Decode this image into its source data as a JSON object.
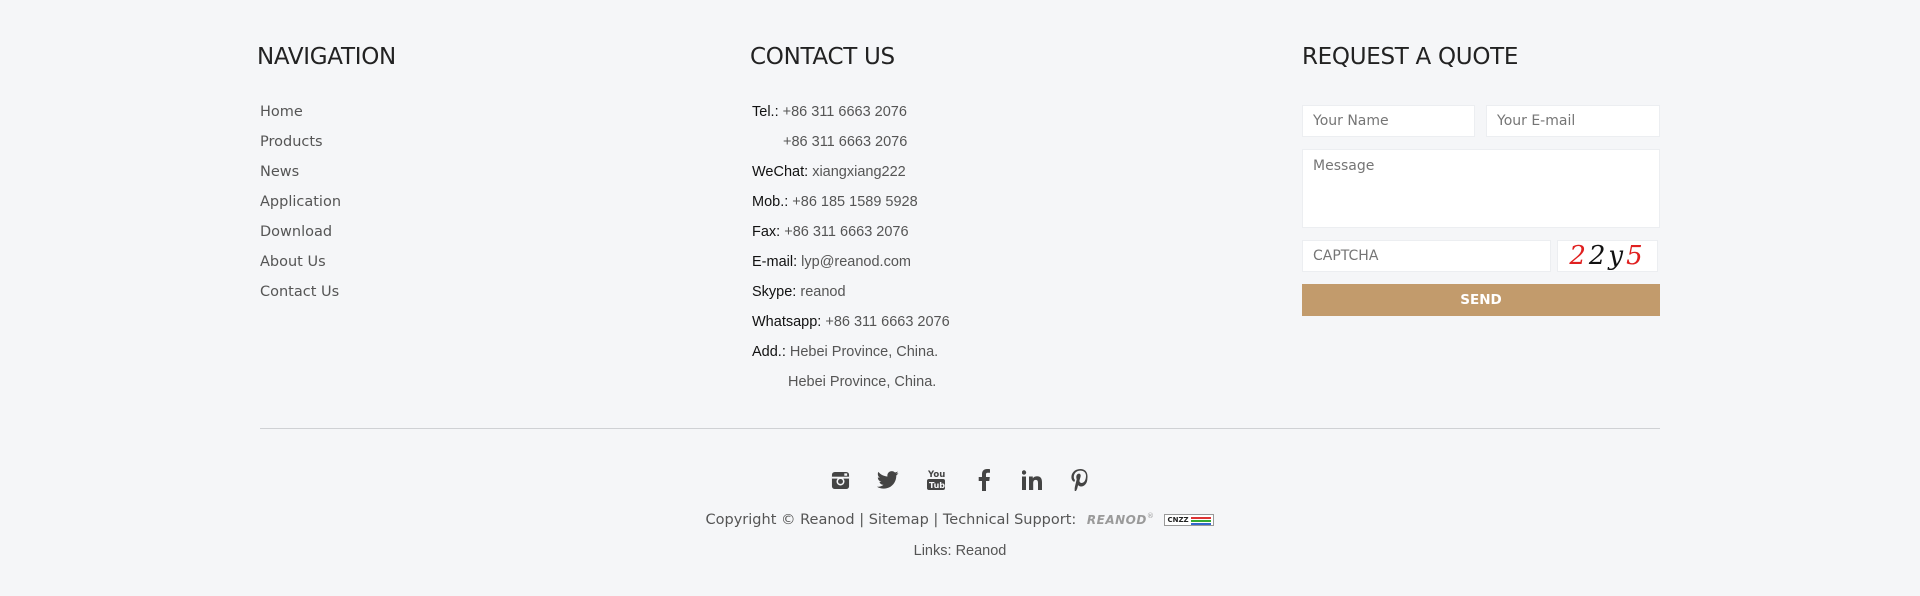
{
  "navigation": {
    "title": "NAVIGATION",
    "items": [
      "Home",
      "Products",
      "News",
      "Application",
      "Download",
      "About Us",
      "Contact Us"
    ]
  },
  "contact": {
    "title": "CONTACT US",
    "rows": [
      {
        "label": "Tel.:",
        "value": "+86 311 6663 2076"
      },
      {
        "label": "",
        "value": "+86 311 6663 2076"
      },
      {
        "label": "WeChat:",
        "value": "xiangxiang222"
      },
      {
        "label": "Mob.:",
        "value": "+86 185 1589 5928"
      },
      {
        "label": "Fax:",
        "value": "+86 311 6663 2076"
      },
      {
        "label": "E-mail:",
        "value": "lyp@reanod.com"
      },
      {
        "label": "Skype:",
        "value": "reanod"
      },
      {
        "label": "Whatsapp:",
        "value": "+86 311 6663 2076"
      },
      {
        "label": "Add.:",
        "value": "Hebei Province, China."
      },
      {
        "label": "",
        "value": "Hebei Province, China."
      }
    ]
  },
  "quote": {
    "title": "REQUEST A QUOTE",
    "name_placeholder": "Your Name",
    "email_placeholder": "Your E-mail",
    "message_placeholder": "Message",
    "captcha_placeholder": "CAPTCHA",
    "captcha_chars": [
      {
        "ch": "2",
        "color": "#e02020"
      },
      {
        "ch": "2",
        "color": "#111111"
      },
      {
        "ch": "y",
        "color": "#111111"
      },
      {
        "ch": "5",
        "color": "#e02020"
      }
    ],
    "send_label": "SEND"
  },
  "social": [
    "instagram-icon",
    "twitter-icon",
    "youtube-icon",
    "facebook-icon",
    "linkedin-icon",
    "pinterest-icon"
  ],
  "footer": {
    "copyright_prefix": "Copyright © Reanod",
    "sep1": "|",
    "sitemap": "Sitemap",
    "sep2": "|",
    "tech_support": "Technical Support:",
    "reanod_logo": "REANOD",
    "cnzz_logo": "CNZZ",
    "links_label": "Links:",
    "links_item": "Reanod"
  },
  "colors": {
    "accent": "#c29b6c",
    "background": "#f5f6f8",
    "captcha_red": "#e02020"
  }
}
